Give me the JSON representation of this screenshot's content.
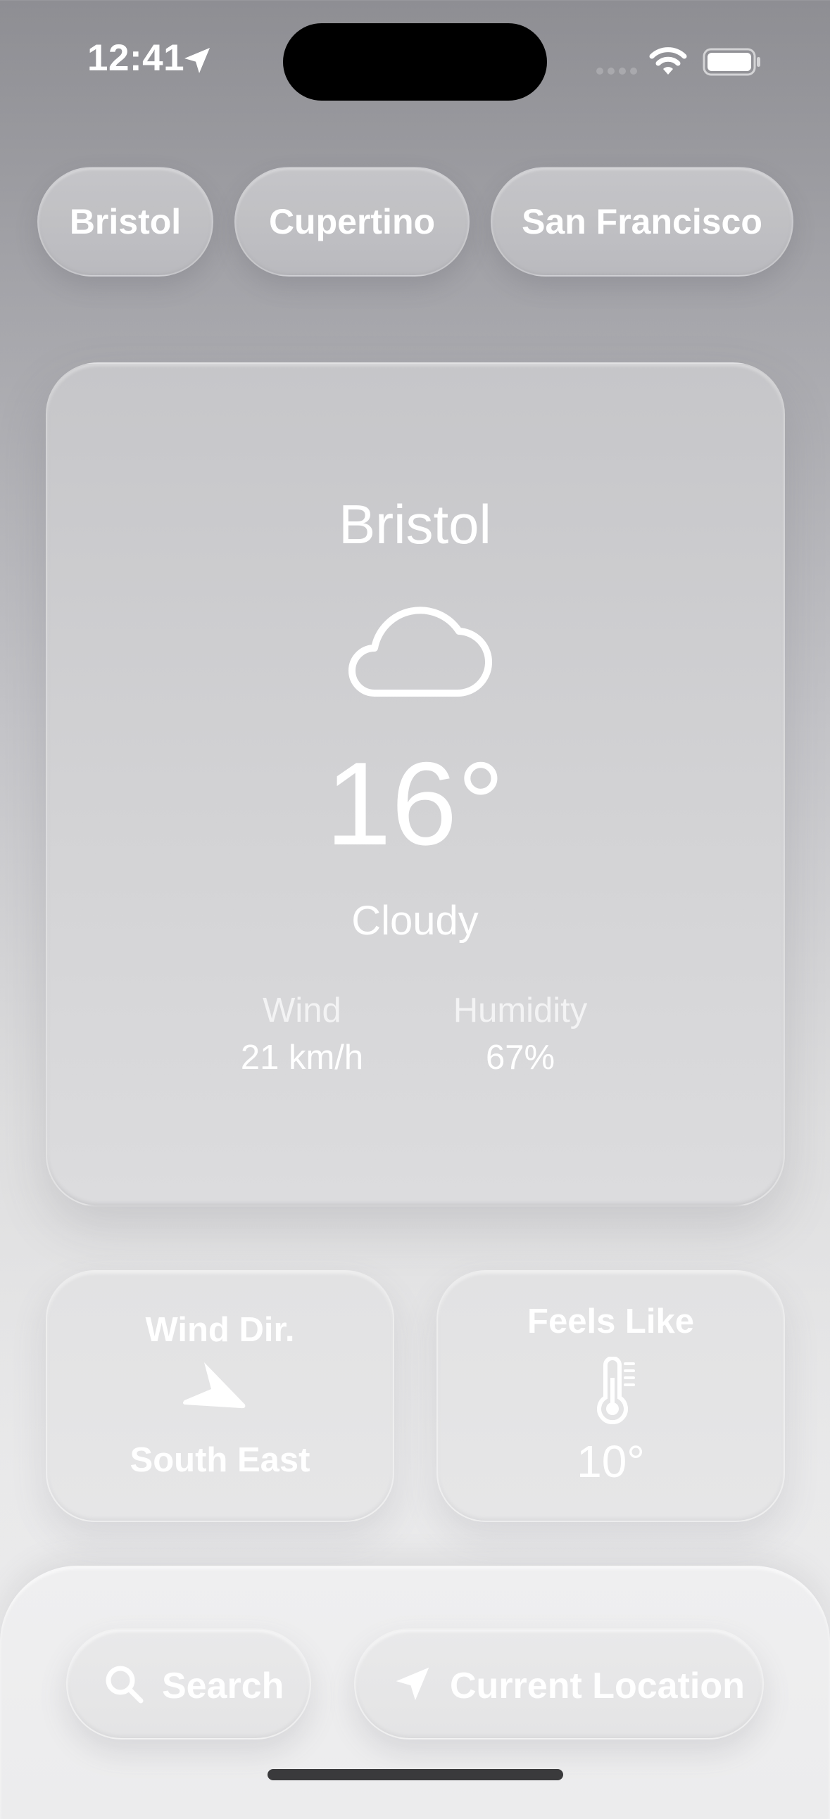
{
  "status_bar": {
    "time": "12:41",
    "location_icon": "location-arrow-icon",
    "wifi_icon": "wifi-icon",
    "battery_icon": "battery-icon"
  },
  "city_tabs": [
    {
      "label": "Bristol"
    },
    {
      "label": "Cupertino"
    },
    {
      "label": "San Francisco"
    }
  ],
  "weather": {
    "city": "Bristol",
    "icon": "cloud-icon",
    "temperature": "16°",
    "condition": "Cloudy",
    "wind_label": "Wind",
    "wind_value": "21 km/h",
    "humidity_label": "Humidity",
    "humidity_value": "67%"
  },
  "wind_direction": {
    "title": "Wind Dir.",
    "icon": "direction-arrow-icon",
    "value": "South East"
  },
  "feels_like": {
    "title": "Feels Like",
    "icon": "thermometer-icon",
    "value": "10°"
  },
  "bottom_bar": {
    "search_label": "Search",
    "search_icon": "search-icon",
    "current_location_label": "Current Location",
    "current_location_icon": "location-arrow-icon"
  }
}
